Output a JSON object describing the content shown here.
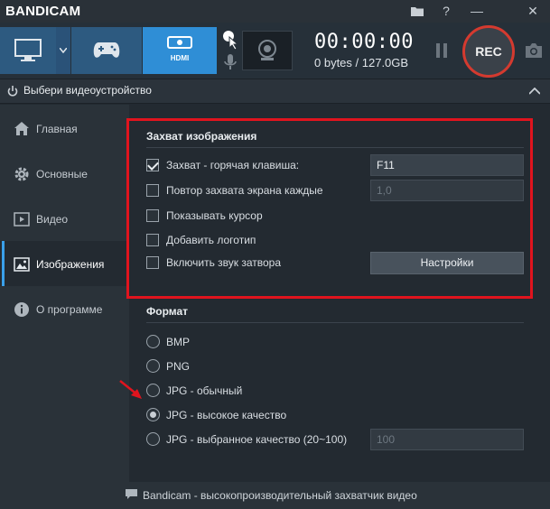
{
  "app": {
    "name": "BANDICAM"
  },
  "titlebar": {
    "folder_icon": "folder-icon",
    "help_label": "?",
    "minimize_label": "—",
    "close_label": "✕"
  },
  "toolbar": {
    "timer": "00:00:00",
    "size_info": "0 bytes / 127.0GB",
    "hdmi_label": "HDMI",
    "rec_label": "REC"
  },
  "device_bar": {
    "text": "Выбери видеоустройство"
  },
  "sidebar": {
    "items": [
      {
        "label": "Главная",
        "icon": "home-icon"
      },
      {
        "label": "Основные",
        "icon": "gear-icon"
      },
      {
        "label": "Видео",
        "icon": "video-icon"
      },
      {
        "label": "Изображения",
        "icon": "image-icon"
      },
      {
        "label": "О программе",
        "icon": "info-icon"
      }
    ],
    "active_index": 3
  },
  "capture": {
    "title": "Захват изображения",
    "options": [
      {
        "label": "Захват - горячая клавиша:",
        "checked": true,
        "value": "F11"
      },
      {
        "label": "Повтор захвата экрана каждые",
        "checked": false,
        "value": "1,0"
      },
      {
        "label": "Показывать курсор",
        "checked": false
      },
      {
        "label": "Добавить логотип",
        "checked": false
      },
      {
        "label": "Включить звук затвора",
        "checked": false
      }
    ],
    "settings_label": "Настройки"
  },
  "format": {
    "title": "Формат",
    "options": [
      {
        "label": "BMP",
        "selected": false
      },
      {
        "label": "PNG",
        "selected": false
      },
      {
        "label": "JPG - обычный",
        "selected": false
      },
      {
        "label": "JPG - высокое качество",
        "selected": true
      },
      {
        "label": "JPG - выбранное качество (20~100)",
        "selected": false,
        "value": "100"
      }
    ]
  },
  "footer": {
    "text": "Bandicam - высокопроизводительный захватчик видео"
  },
  "colors": {
    "accent": "#2f8ed6",
    "rec_ring": "#d43a2f",
    "highlight_frame": "#e0141e"
  }
}
